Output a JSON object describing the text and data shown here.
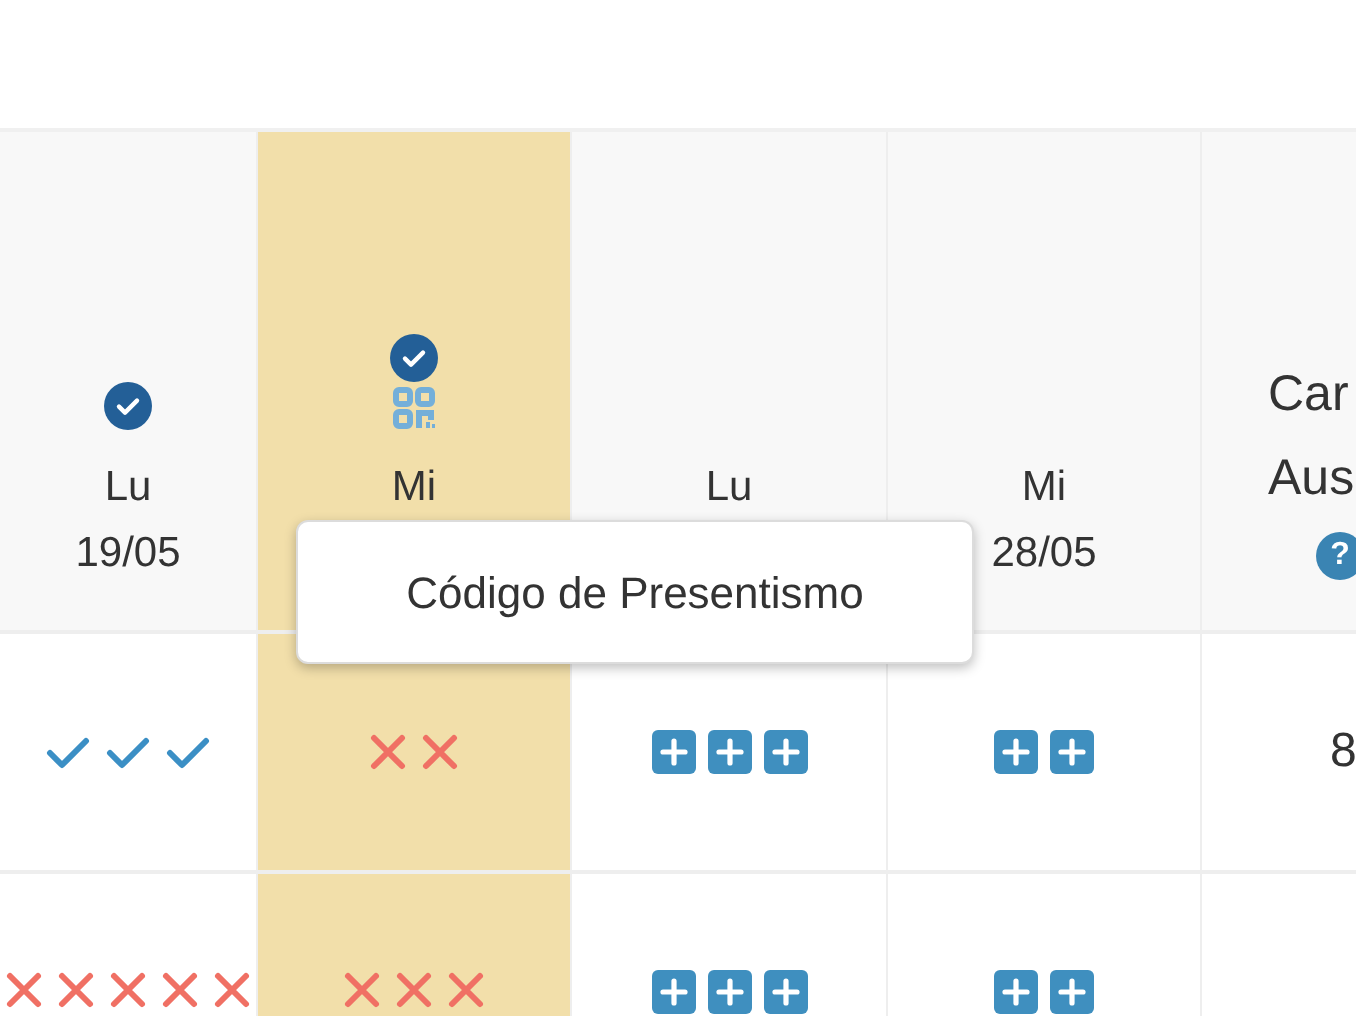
{
  "columns": [
    {
      "kind": "day",
      "day": "Lu",
      "date": "19/05",
      "selected": false,
      "icons": [
        {
          "kind": "check"
        }
      ]
    },
    {
      "kind": "day",
      "day": "Mi",
      "selected": true,
      "icons": [
        {
          "kind": "check"
        },
        {
          "kind": "qr"
        }
      ]
    },
    {
      "kind": "day",
      "day": "Lu",
      "selected": false
    },
    {
      "kind": "day",
      "day": "Mi",
      "date": "28/05",
      "selected": false
    },
    {
      "kind": "total",
      "lines": [
        "Car",
        "Aus"
      ],
      "help": "?",
      "selected": false
    }
  ],
  "rows": [
    {
      "cells": [
        {
          "marks": [
            {
              "kind": "check"
            },
            {
              "kind": "check"
            },
            {
              "kind": "check"
            }
          ]
        },
        {
          "marks": [
            {
              "kind": "cross"
            },
            {
              "kind": "cross"
            }
          ]
        },
        {
          "marks": [
            {
              "kind": "plus"
            },
            {
              "kind": "plus"
            },
            {
              "kind": "plus"
            }
          ]
        },
        {
          "marks": [
            {
              "kind": "plus"
            },
            {
              "kind": "plus"
            }
          ]
        }
      ],
      "total": "8"
    },
    {
      "cells": [
        {
          "marks": [
            {
              "kind": "cross"
            },
            {
              "kind": "cross"
            },
            {
              "kind": "cross"
            },
            {
              "kind": "cross"
            },
            {
              "kind": "cross"
            }
          ]
        },
        {
          "marks": [
            {
              "kind": "cross"
            },
            {
              "kind": "cross"
            },
            {
              "kind": "cross"
            }
          ]
        },
        {
          "marks": [
            {
              "kind": "plus"
            },
            {
              "kind": "plus"
            },
            {
              "kind": "plus"
            }
          ]
        },
        {
          "marks": [
            {
              "kind": "plus"
            },
            {
              "kind": "plus"
            }
          ]
        }
      ]
    }
  ],
  "tooltip": {
    "text": "Código de Presentismo"
  }
}
